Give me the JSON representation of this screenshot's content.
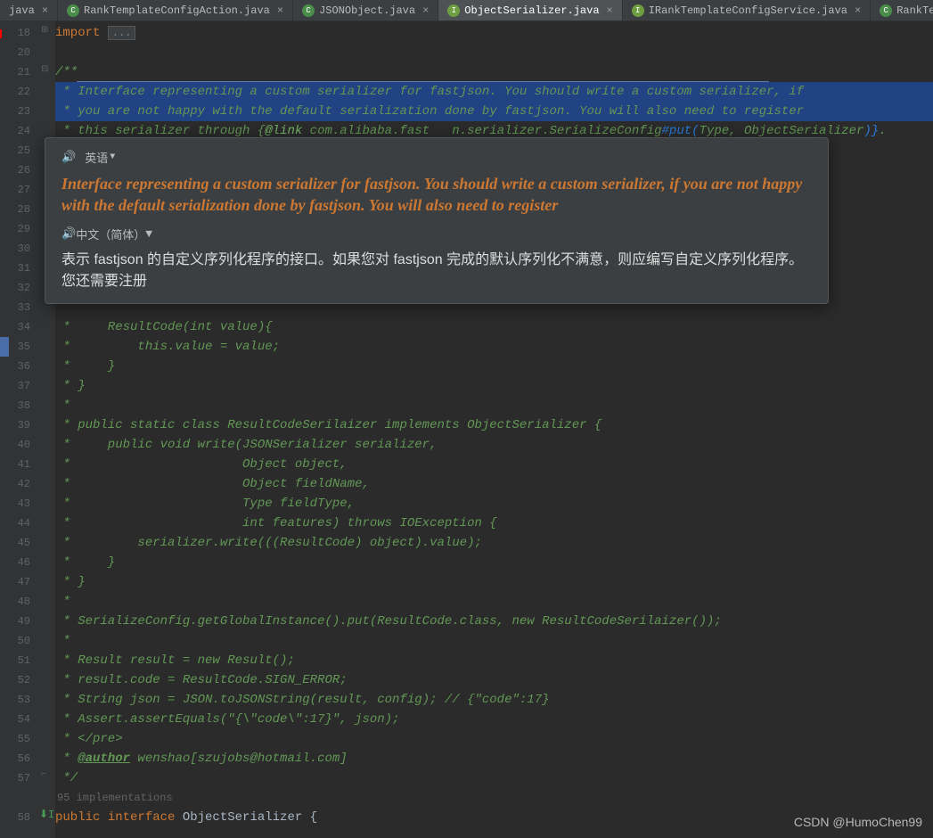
{
  "tabs": [
    {
      "label": "java",
      "icon": "",
      "active": false
    },
    {
      "label": "RankTemplateConfigAction.java",
      "icon": "C",
      "iconClass": "icon-class",
      "active": false
    },
    {
      "label": "JSONObject.java",
      "icon": "C",
      "iconClass": "icon-class",
      "active": false
    },
    {
      "label": "ObjectSerializer.java",
      "icon": "I",
      "iconClass": "icon-interface",
      "active": true
    },
    {
      "label": "IRankTemplateConfigService.java",
      "icon": "I",
      "iconClass": "icon-interface",
      "active": false
    },
    {
      "label": "RankTemplateConfigServiceI",
      "icon": "C",
      "iconClass": "icon-class",
      "active": false
    }
  ],
  "lineStart": 18,
  "lineEnd": 58,
  "import": {
    "keyword": "import",
    "fold": "..."
  },
  "doc": {
    "open": "/**",
    "l22": " * Interface representing a custom serializer for fastjson. You should write a custom serializer, if",
    "l23": " * you are not happy with the default serialization done by fastjson. You will also need to register",
    "l24_pre": " * this serializer through {",
    "l24_link": "@link",
    "l24_mid": " com.alibaba.fast   n.serializer.SerializeConfig",
    "l24_put": "#put(",
    "l24_after": "Type, ObjectSerializer",
    "l24_close": ")}",
    "l24_dot": ".",
    "l34": " *     ResultCode(int value){",
    "l35": " *         this.value = value;",
    "l36": " *     }",
    "l37": " * }",
    "l38": " *",
    "l39": " * public static class ResultCodeSerilaizer implements ObjectSerializer {",
    "l40": " *     public void write(JSONSerializer serializer,",
    "l41": " *                       Object object,",
    "l42": " *                       Object fieldName,",
    "l43": " *                       Type fieldType,",
    "l44": " *                       int features) throws IOException {",
    "l45": " *         serializer.write(((ResultCode) object).value);",
    "l46": " *     }",
    "l47": " * }",
    "l48": " *",
    "l49": " * SerializeConfig.getGlobalInstance().put(ResultCode.class, new ResultCodeSerilaizer());",
    "l50": " *",
    "l51": " * Result result = new Result();",
    "l52": " * result.code = ResultCode.SIGN_ERROR;",
    "l53": " * String json = JSON.toJSONString(result, config); // {\"code\":17}",
    "l54": " * Assert.assertEquals(\"{\\\"code\\\":17}\", json);",
    "l55": " * </pre>",
    "l56_pre": " * ",
    "l56_tag": "@author",
    "l56_post": " wenshao[szujobs@hotmail.com]",
    "close": " */"
  },
  "hints": "95 implementations",
  "decl": {
    "public": "public ",
    "interface": "interface ",
    "name": "ObjectSerializer ",
    "brace": "{"
  },
  "popup": {
    "sourceLang": "英语",
    "sourceText": "Interface representing a custom serializer for fastjson. You should write a custom serializer, if you are not happy with the default serialization done by fastjson. You will also need to register",
    "targetLang": "中文（简体）",
    "targetText": "表示 fastjson 的自定义序列化程序的接口。如果您对 fastjson 完成的默认序列化不满意，则应编写自定义序列化程序。您还需要注册"
  },
  "watermark": "CSDN @HumoChen99"
}
